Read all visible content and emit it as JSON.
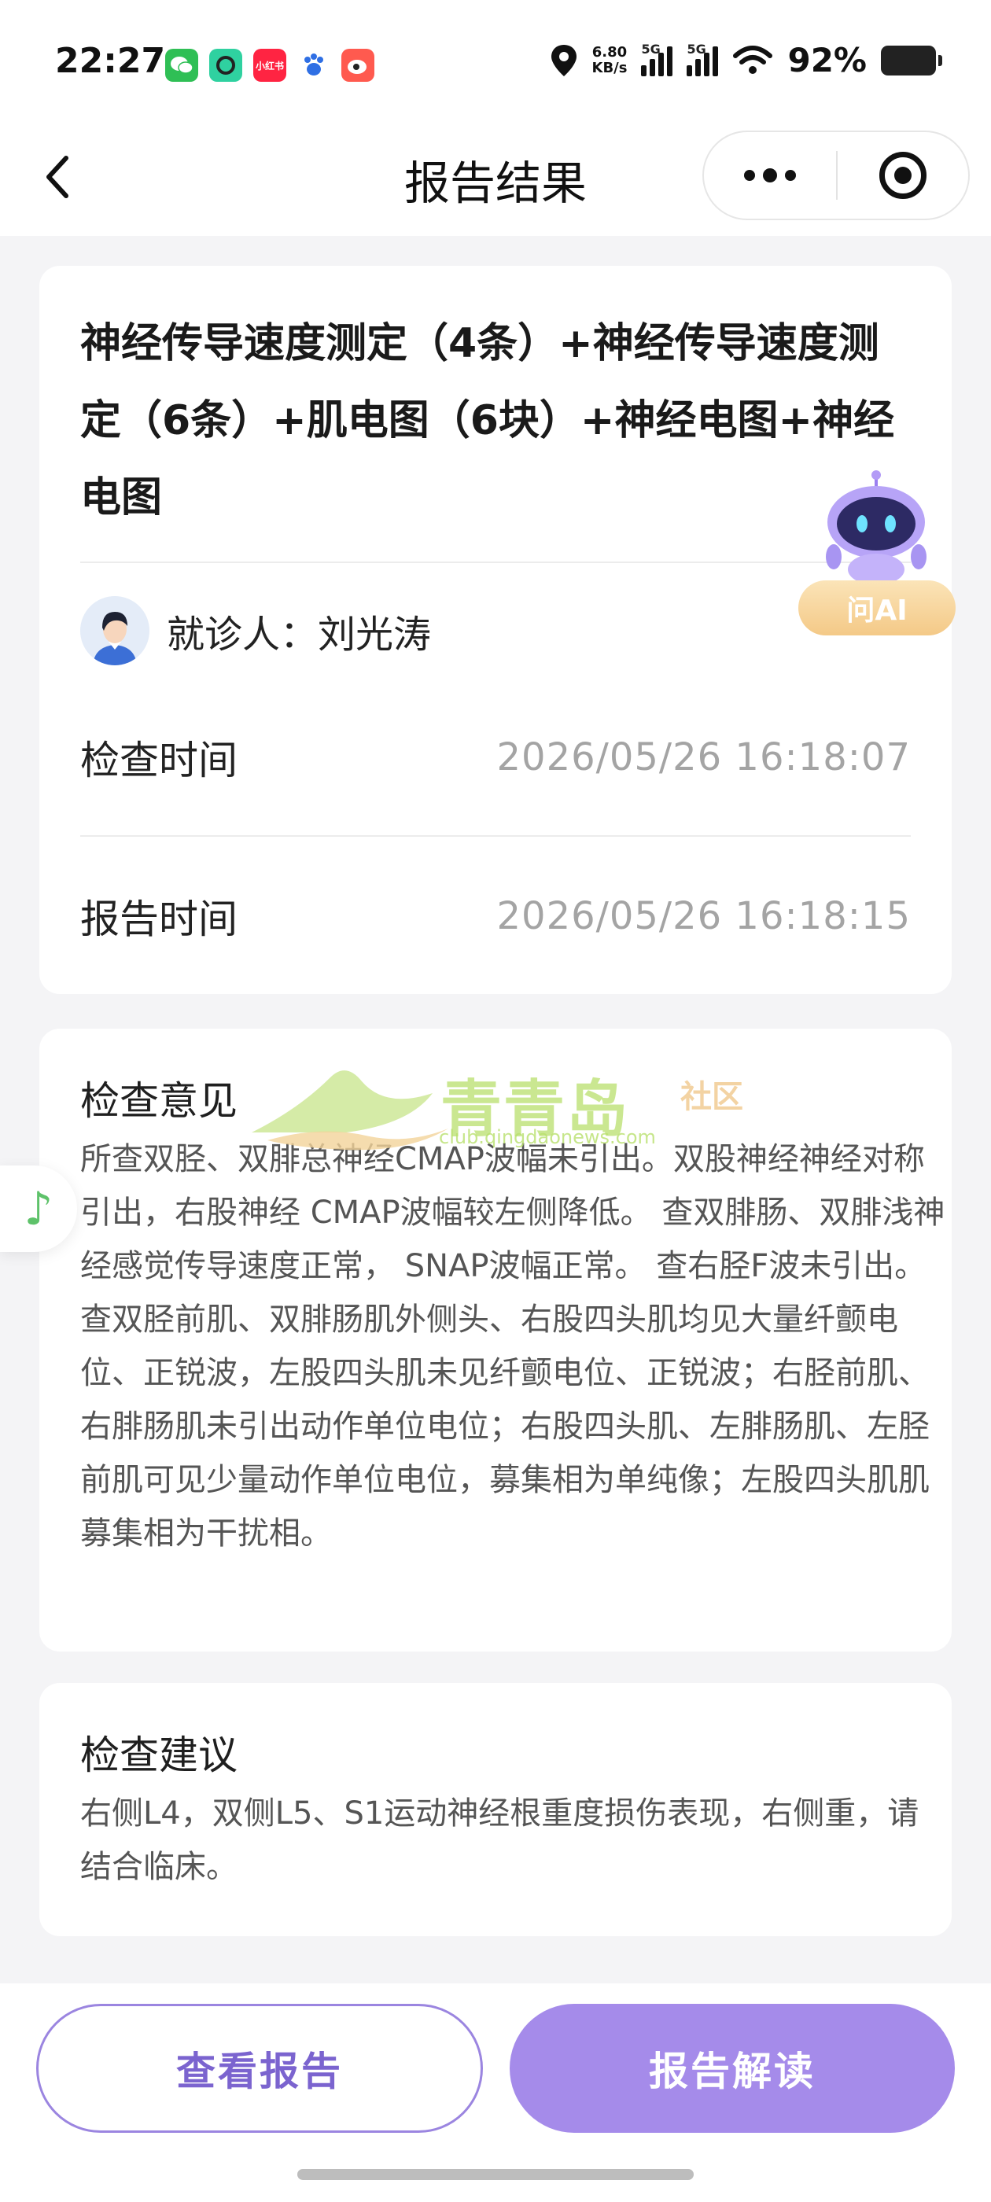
{
  "status_bar": {
    "time": "22:27",
    "apps": [
      "wechat-icon",
      "camera-icon",
      "xiaohongshu-icon",
      "baidu-icon",
      "weibo-icon"
    ],
    "xiaohongshu_label": "小红书",
    "net_speed_value": "6.80",
    "net_speed_unit": "KB/s",
    "signal_1": "5G",
    "signal_2": "5G",
    "battery": "92%"
  },
  "nav": {
    "title": "报告结果"
  },
  "report": {
    "exam_name": "神经传导速度测定（4条）+神经传导速度测定（6条）+肌电图（6块）+神经电图+神经电图",
    "patient_label": "就诊人：刘光涛",
    "exam_time_label": "检查时间",
    "exam_time_value": "2026/05/26 16:18:07",
    "report_time_label": "报告时间",
    "report_time_value": "2026/05/26 16:18:15"
  },
  "opinion": {
    "title": "检查意见",
    "body": "所查双胫、双腓总神经CMAP波幅未引出。双股神经神经对称引出，右股神经 CMAP波幅较左侧降低。 查双腓肠、双腓浅神经感觉传导速度正常， SNAP波幅正常。 查右胫F波未引出。 查双胫前肌、双腓肠肌外侧头、右股四头肌均见大量纤颤电位、正锐波，左股四头肌未见纤颤电位、正锐波；右胫前肌、右腓肠肌未引出动作单位电位；右股四头肌、左腓肠肌、左胫前肌可见少量动作单位电位，募集相为单纯像；左股四头肌肌募集相为干扰相。"
  },
  "suggestion": {
    "title": "检查建议",
    "body": "右侧L4，双侧L5、S1运动神经根重度损伤表现，右侧重，请结合临床。"
  },
  "watermark": {
    "name": "青青岛",
    "tag": "社区",
    "url": "club.qingdaonews.com"
  },
  "ai_float": {
    "label": "问AI"
  },
  "actions": {
    "view_report": "查看报告",
    "interpret_report": "报告解读"
  },
  "colors": {
    "accent": "#a58bea",
    "accent_text": "#7b64cf",
    "background": "#f4f4f6"
  }
}
